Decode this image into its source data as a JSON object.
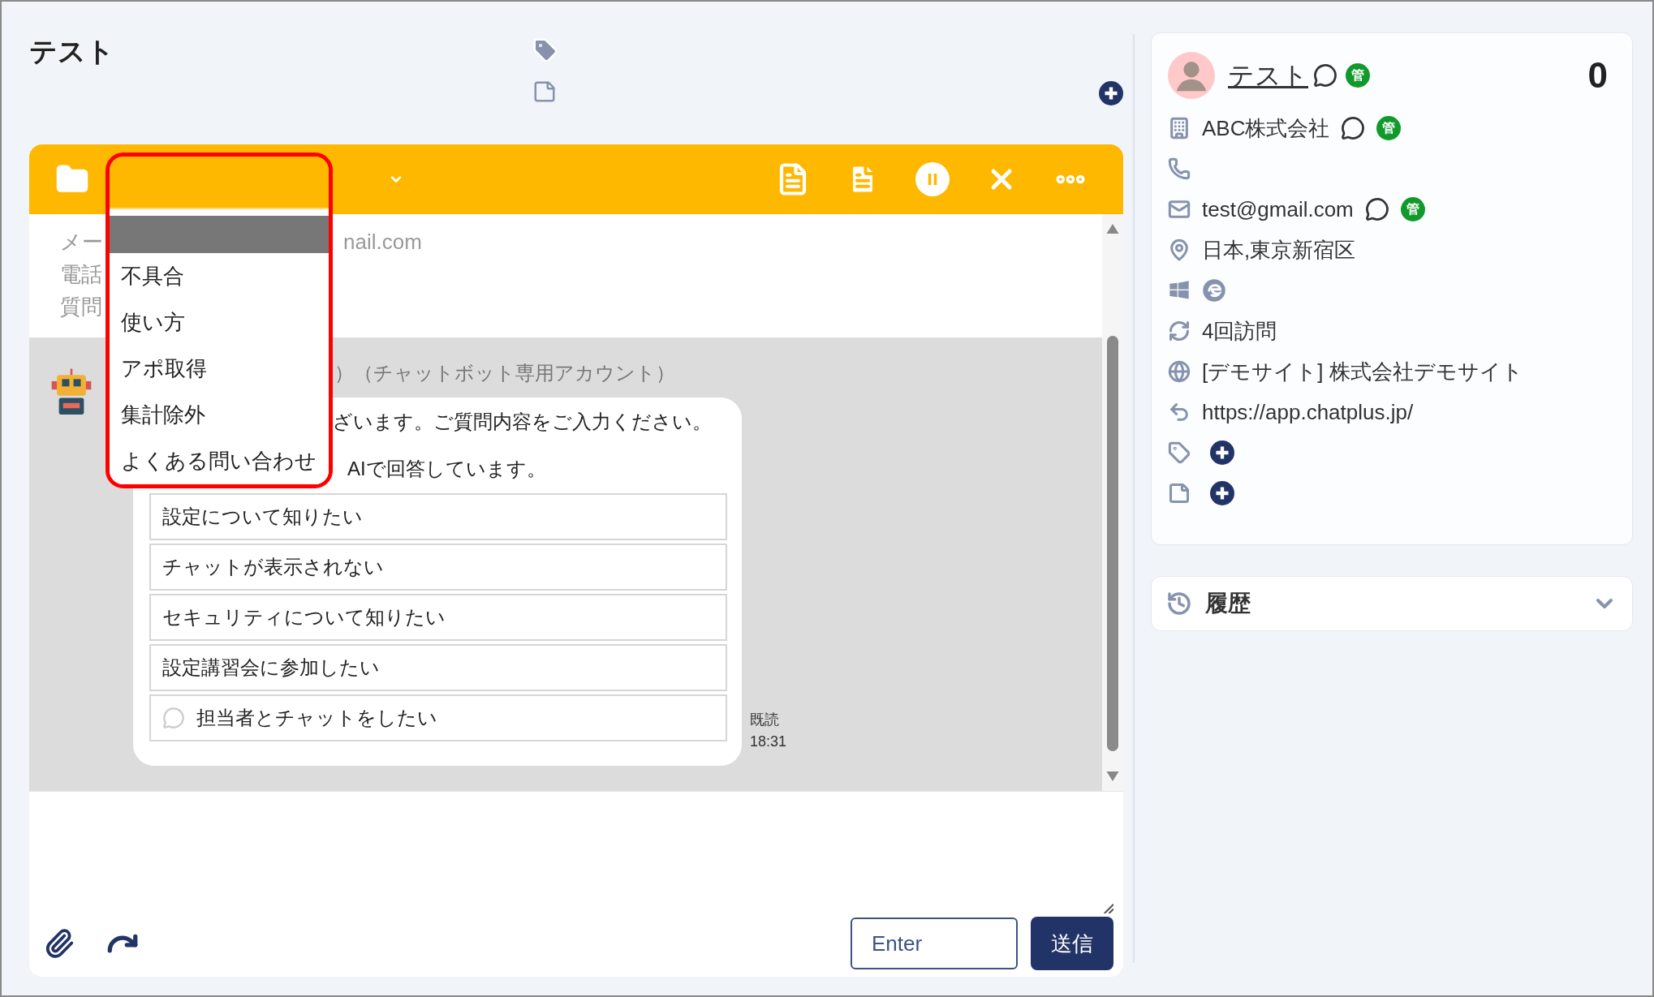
{
  "title": "テスト",
  "dropdown": {
    "highlight": true,
    "options": [
      {
        "selected": true
      },
      {
        "label": "不具合",
        "selected": false
      },
      {
        "label": "使い方",
        "selected": false
      },
      {
        "label": "アポ取得",
        "selected": false
      },
      {
        "label": "集計除外",
        "selected": false
      },
      {
        "label": "よくある問い合わせ",
        "selected": false
      }
    ]
  },
  "visitor_info": {
    "labels": [
      "メー",
      "電話",
      "質問"
    ],
    "email": "nail.com"
  },
  "bot": {
    "name": "）（チャットボット専用アカウント）",
    "lines": [
      "ざいます。ご質問内容をご入力ください。",
      "AIで回答しています。"
    ],
    "choices": [
      {
        "label": "設定について知りたい",
        "kind": "choice"
      },
      {
        "label": "チャットが表示されない",
        "kind": "choice"
      },
      {
        "label": "セキュリティについて知りたい",
        "kind": "choice"
      },
      {
        "label": "設定講習会に参加したい",
        "kind": "choice"
      },
      {
        "label": "担当者とチャットをしたい",
        "kind": "operator"
      }
    ],
    "read": "既読",
    "time": "18:31"
  },
  "composer": {
    "send_key": "Enter",
    "send": "送信"
  },
  "profile": {
    "name": "テスト",
    "name_admin": "管",
    "score": "0",
    "rows": [
      {
        "kind": "company",
        "text": "ABC株式会社",
        "admin": "管"
      },
      {
        "kind": "phone"
      },
      {
        "kind": "email",
        "text": "test@gmail.com",
        "admin": "管"
      },
      {
        "kind": "location",
        "text": "日本,東京新宿区"
      },
      {
        "kind": "environment"
      },
      {
        "kind": "visits",
        "text": "4回訪問"
      },
      {
        "kind": "site",
        "text": "[デモサイト] 株式会社デモサイト"
      },
      {
        "kind": "referrer",
        "text": "https://app.chatplus.jp/"
      },
      {
        "kind": "tags"
      },
      {
        "kind": "memo"
      }
    ]
  },
  "history": {
    "label": "履歴",
    "expanded": false
  }
}
